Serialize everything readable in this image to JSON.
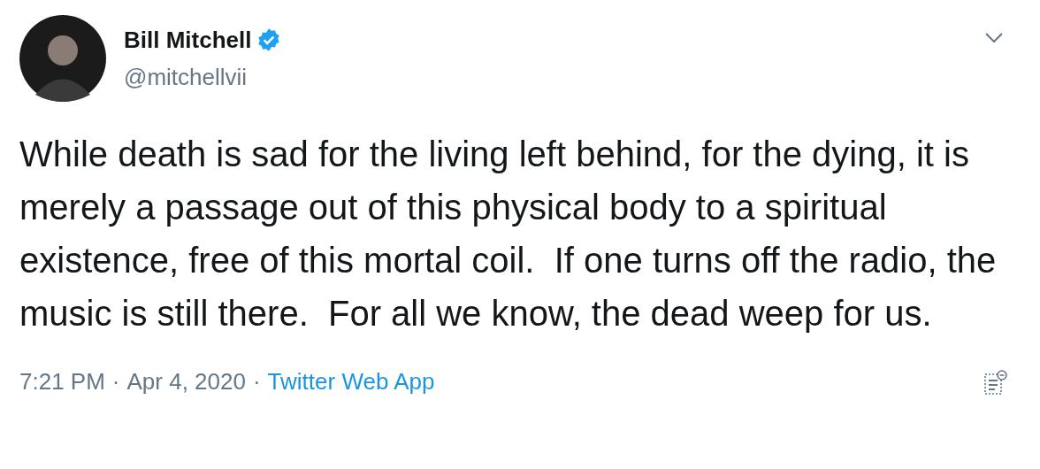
{
  "author": {
    "name": "Bill Mitchell",
    "verified": true,
    "handle": "@mitchellvii"
  },
  "text": "While death is sad for the living left behind, for the dying, it is merely a passage out of this physical body to a spiritual existence, free of this mortal coil.  If one turns off the radio, the music is still there.  For all we know, the dead weep for us.",
  "footer": {
    "time": "7:21 PM",
    "separator": "·",
    "date": "Apr 4, 2020",
    "source": "Twitter Web App"
  }
}
